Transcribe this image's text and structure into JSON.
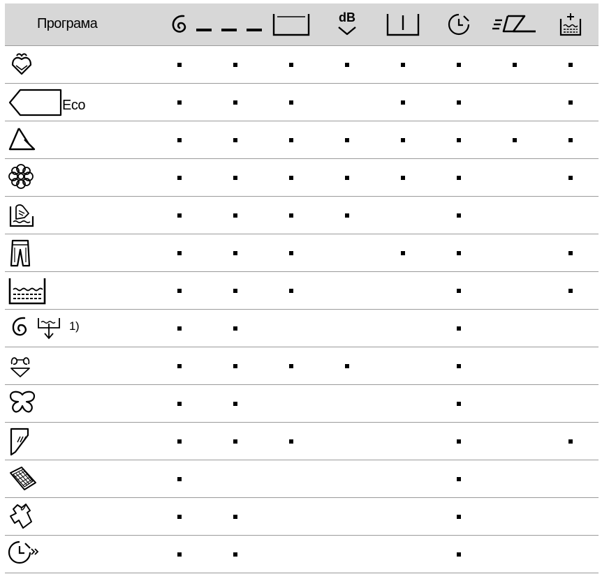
{
  "header": {
    "program_label": "Програма",
    "columns": [
      {
        "icon": "spin-icon"
      },
      {
        "icon": "dashed-line-icon"
      },
      {
        "icon": "prewash-tray-icon"
      },
      {
        "icon": "db-low-noise-icon",
        "text": "dB"
      },
      {
        "icon": "stain-tray-icon"
      },
      {
        "icon": "timer-icon"
      },
      {
        "icon": "easy-iron-icon"
      },
      {
        "icon": "extra-rinse-icon"
      }
    ]
  },
  "programs": [
    {
      "icon": "cotton-icon",
      "label": "",
      "marks": [
        1,
        1,
        1,
        1,
        1,
        1,
        1,
        1
      ]
    },
    {
      "icon": "eco-tag-icon",
      "label": "Eco",
      "marks": [
        1,
        1,
        1,
        0,
        1,
        1,
        0,
        1
      ]
    },
    {
      "icon": "synthetics-icon",
      "label": "",
      "marks": [
        1,
        1,
        1,
        1,
        1,
        1,
        1,
        1
      ]
    },
    {
      "icon": "delicates-flower-icon",
      "label": "",
      "marks": [
        1,
        1,
        1,
        1,
        1,
        1,
        0,
        1
      ]
    },
    {
      "icon": "hand-wash-wool-icon",
      "label": "",
      "marks": [
        1,
        1,
        1,
        1,
        0,
        1,
        0,
        0
      ]
    },
    {
      "icon": "jeans-icon",
      "label": "",
      "marks": [
        1,
        1,
        1,
        0,
        1,
        1,
        0,
        1
      ]
    },
    {
      "icon": "rinse-icon",
      "label": "",
      "marks": [
        1,
        1,
        1,
        0,
        0,
        1,
        0,
        1
      ]
    },
    {
      "icon": "spin-drain-icon",
      "label": "1)",
      "marks": [
        1,
        1,
        0,
        0,
        0,
        1,
        0,
        0
      ]
    },
    {
      "icon": "lingerie-icon",
      "label": "",
      "marks": [
        1,
        1,
        1,
        1,
        0,
        1,
        0,
        0
      ]
    },
    {
      "icon": "silk-butterfly-icon",
      "label": "",
      "marks": [
        1,
        1,
        0,
        0,
        0,
        1,
        0,
        0
      ]
    },
    {
      "icon": "curtains-icon",
      "label": "",
      "marks": [
        1,
        1,
        1,
        0,
        0,
        1,
        0,
        1
      ]
    },
    {
      "icon": "duvet-icon",
      "label": "",
      "marks": [
        1,
        0,
        0,
        0,
        0,
        1,
        0,
        0
      ]
    },
    {
      "icon": "sportswear-icon",
      "label": "",
      "marks": [
        1,
        1,
        0,
        0,
        0,
        1,
        0,
        0
      ]
    },
    {
      "icon": "quick-timer-icon",
      "label": "",
      "marks": [
        1,
        1,
        0,
        0,
        0,
        1,
        0,
        0
      ]
    }
  ]
}
